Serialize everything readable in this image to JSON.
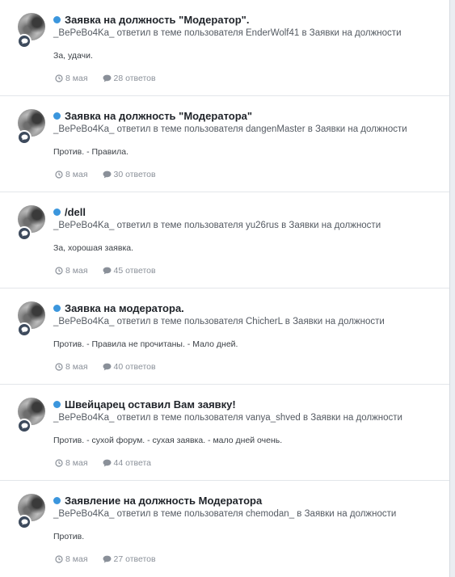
{
  "feed": {
    "items": [
      {
        "title": "Заявка на должность \"Модератор\".",
        "byline": "_BePeBo4Ka_ ответил в теме пользователя EnderWolf41 в Заявки на должности",
        "snippet": "За, удачи.",
        "date": "8 мая",
        "replies": "28 ответов"
      },
      {
        "title": "Заявка на должность \"Модератора\"",
        "byline": "_BePeBo4Ka_ ответил в теме пользователя dangenMaster в Заявки на должности",
        "snippet": "Против. - Правила.",
        "date": "8 мая",
        "replies": "30 ответов"
      },
      {
        "title": "/dell",
        "byline": "_BePeBo4Ka_ ответил в теме пользователя yu26rus в Заявки на должности",
        "snippet": "За, хорошая заявка.",
        "date": "8 мая",
        "replies": "45 ответов"
      },
      {
        "title": "Заявка на модератора.",
        "byline": "_BePeBo4Ka_ ответил в теме пользователя ChicherL в Заявки на должности",
        "snippet": "Против. - Правила не прочитаны. - Мало дней.",
        "date": "8 мая",
        "replies": "40 ответов"
      },
      {
        "title": "Швейцарец оставил Вам заявку!",
        "byline": "_BePeBo4Ka_ ответил в теме пользователя vanya_shved в Заявки на должности",
        "snippet": "Против. - сухой форум. - сухая заявка. - мало дней очень.",
        "date": "8 мая",
        "replies": "44 ответа"
      },
      {
        "title": "Заявление на должность Модератора",
        "byline": "_BePeBo4Ka_ ответил в теме пользователя chemodan_ в Заявки на должности",
        "snippet": "Против.",
        "date": "8 мая",
        "replies": "27 ответов"
      }
    ]
  },
  "icons": {
    "badge": "comment-icon",
    "date": "clock-icon",
    "replies": "comment-icon"
  },
  "colors": {
    "unread_dot": "#3b96dd",
    "badge": "#3d4a5c",
    "meta_text": "#8a9099",
    "title_text": "#1f2329"
  }
}
